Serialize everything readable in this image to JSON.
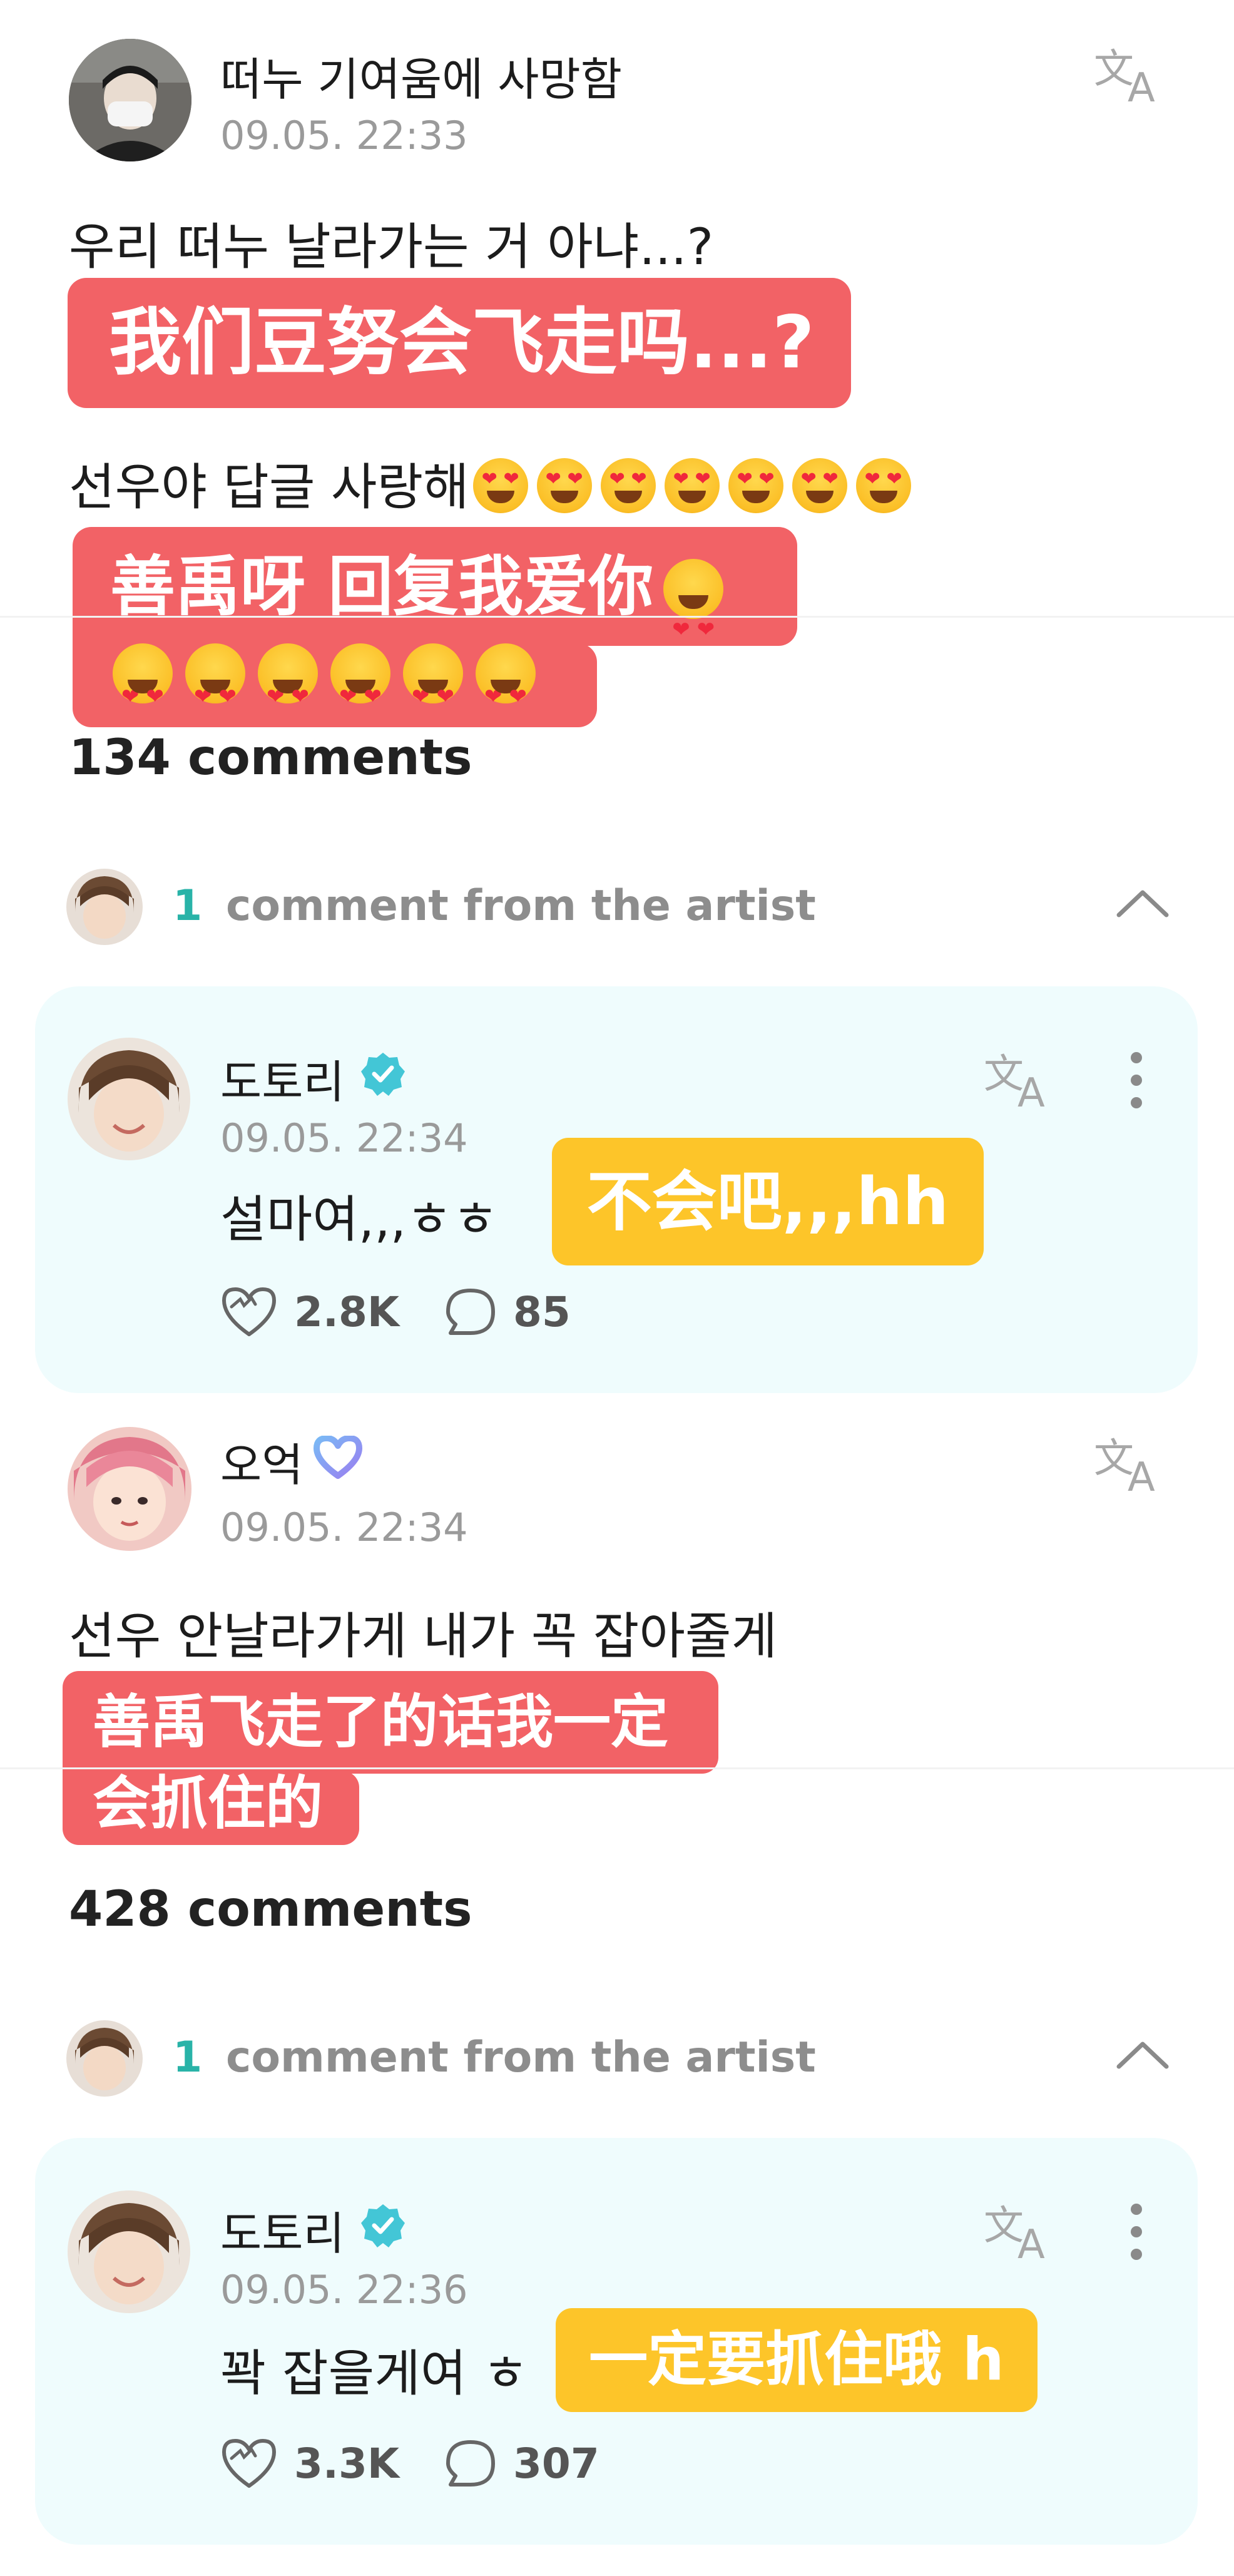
{
  "post1": {
    "author": "떠누 기여움에 사망함",
    "time": "09.05. 22:33",
    "line1": "우리 떠누 날라가는 거 아냐...?",
    "line1_translation": "我们豆努会飞走吗...?",
    "line2": "선우야 답글 사랑해",
    "line2_emoji_count": 7,
    "line2_translation_line1": "善禹呀 回复我爱你",
    "line2_translation_line2_emoji_count": 6,
    "comments_count": "134 comments",
    "artist_count": "1",
    "artist_label": "comment from the artist",
    "reply": {
      "author": "도토리",
      "time": "09.05. 22:34",
      "text": "설마여,,,ㅎㅎ",
      "translation": "不会吧,,,hh",
      "likes": "2.8K",
      "replies": "85"
    }
  },
  "post2": {
    "author": "오억",
    "time": "09.05. 22:34",
    "line1": "선우 안날라가게 내가 꼭 잡아줄게",
    "translation_line1": "善禹飞走了的话我一定",
    "translation_line2": "会抓住的",
    "comments_count": "428 comments",
    "artist_count": "1",
    "artist_label": "comment from the artist",
    "reply": {
      "author": "도토리",
      "time": "09.05. 22:36",
      "text": "꽉 잡을게여 ㅎ",
      "translation": "一定要抓住哦 h",
      "likes": "3.3K",
      "replies": "307"
    }
  },
  "icons": {
    "translate": "translate-icon",
    "more": "more-vertical-icon",
    "verified": "verified-badge-icon",
    "membership": "membership-heart-icon",
    "like": "heart-like-icon",
    "reply": "comment-bubble-icon",
    "collapse": "chevron-up-icon"
  },
  "colors": {
    "red_tag": "#f26266",
    "yellow_tag": "#fdc529",
    "card_bg": "#effcfd",
    "accent_teal": "#29b3a8",
    "verified": "#43c6d6"
  }
}
